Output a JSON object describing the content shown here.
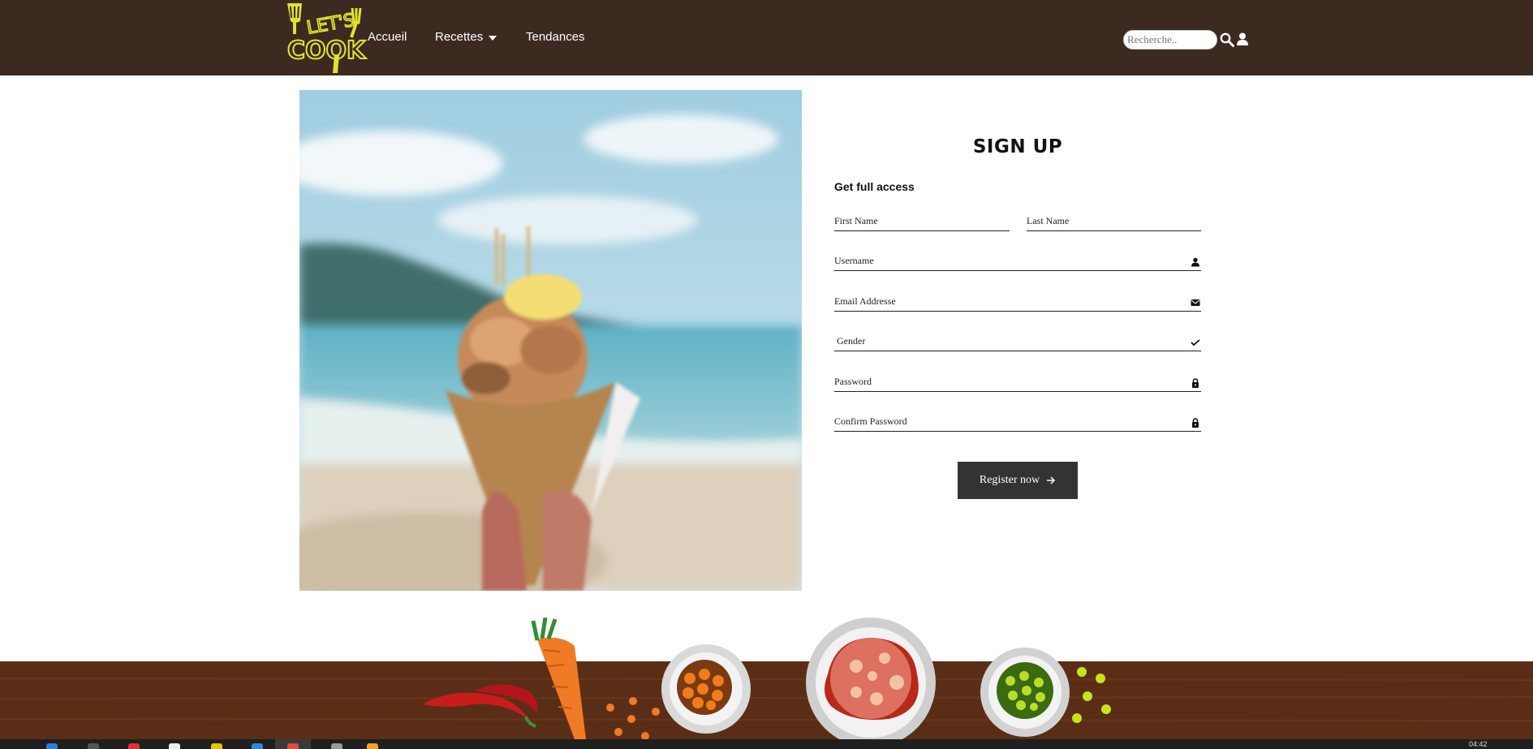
{
  "header": {
    "logo": {
      "name": "lets-cook-logo",
      "text_top": "LET'S",
      "text_bottom": "COOK",
      "color": "#e2e32d"
    },
    "nav": [
      {
        "label": "Accueil"
      },
      {
        "label": "Recettes",
        "has_dropdown": true
      },
      {
        "label": "Tendances"
      }
    ],
    "search": {
      "placeholder": "Recherche.."
    },
    "icons": [
      "search-icon",
      "user-icon"
    ]
  },
  "form": {
    "title": "SIGN UP",
    "subtitle": "Get full access",
    "fields": {
      "first_name": "First Name",
      "last_name": "Last Name",
      "username": "Username",
      "email": "Email Addresse",
      "gender": "Gender",
      "password": "Password",
      "confirm_password": "Confirm Password"
    },
    "field_icons": {
      "username": "user-icon",
      "email": "envelope-icon",
      "gender": "check-icon",
      "password": "lock-icon",
      "confirm_password": "lock-icon"
    },
    "register_label": "Register now"
  },
  "taskbar": {
    "clock": "04:42"
  },
  "colors": {
    "header_bg": "#3c2a21",
    "button_bg": "#333333",
    "footer_wood": "#5a2e16",
    "logo_yellow": "#e2e32d"
  }
}
